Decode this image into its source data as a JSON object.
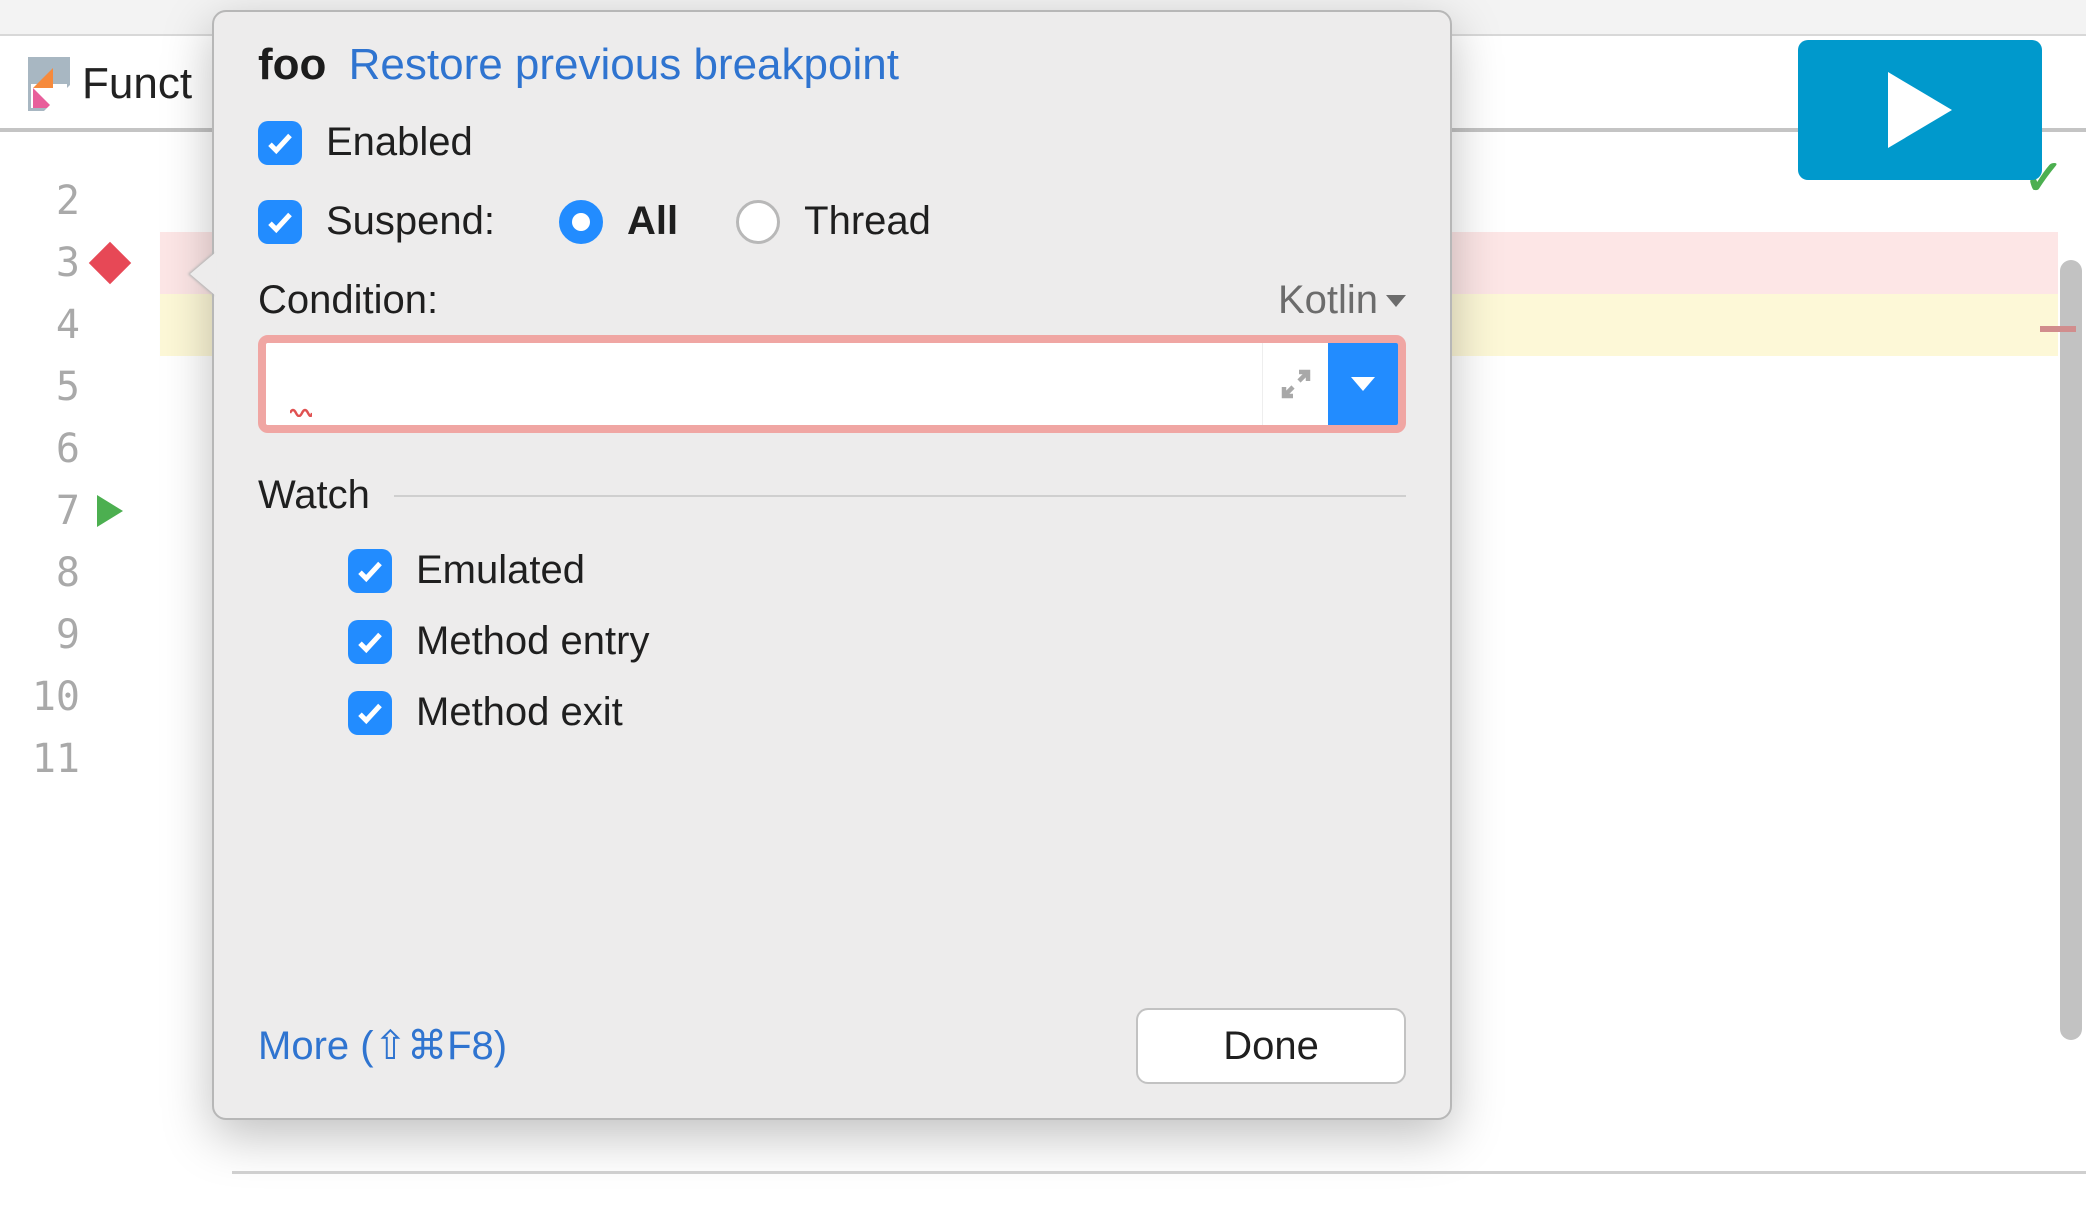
{
  "tab": {
    "label": "Funct"
  },
  "gutter": {
    "lines": [
      "2",
      "3",
      "4",
      "5",
      "6",
      "7",
      "8",
      "9",
      "10",
      "11"
    ],
    "breakpoint_line_index": 1,
    "caret_line_index": 2,
    "run_line_index": 5
  },
  "popup": {
    "function_name": "foo",
    "restore_link": "Restore previous breakpoint",
    "enabled_label": "Enabled",
    "enabled_checked": true,
    "suspend_label": "Suspend:",
    "suspend_checked": true,
    "suspend_options": {
      "all": "All",
      "thread": "Thread",
      "selected": "all"
    },
    "condition_label": "Condition:",
    "language": "Kotlin",
    "condition_value": "",
    "watch_section": "Watch",
    "watch": {
      "emulated": {
        "label": "Emulated",
        "checked": true
      },
      "method_entry": {
        "label": "Method entry",
        "checked": true
      },
      "method_exit": {
        "label": "Method exit",
        "checked": true
      }
    },
    "more_label": "More (⇧⌘F8)",
    "done_label": "Done"
  },
  "status": {
    "code_ok": "✓"
  }
}
